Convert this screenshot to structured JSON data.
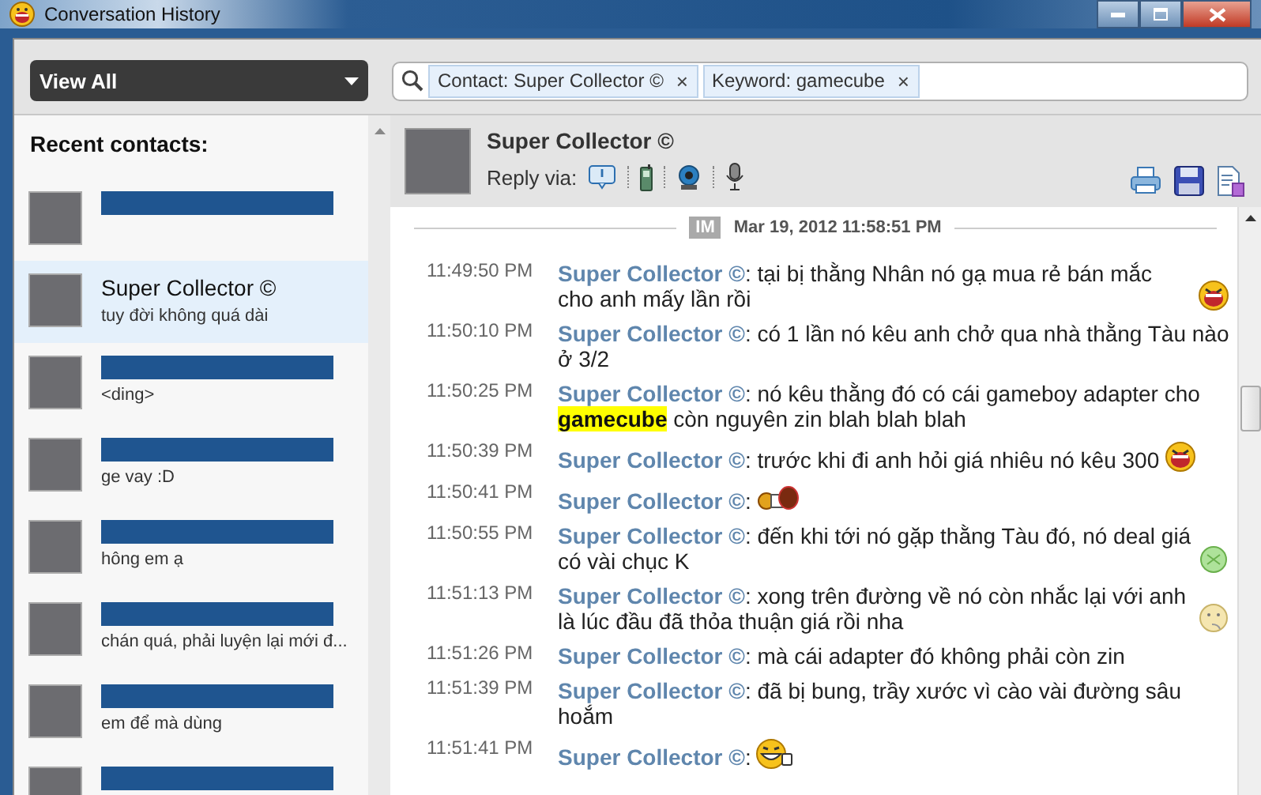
{
  "window": {
    "title": "Conversation History"
  },
  "toolbar": {
    "filter": "View All",
    "search_tokens": [
      {
        "label": "Contact: Super Collector ©",
        "remove": "×"
      },
      {
        "label": "Keyword: gamecube",
        "remove": "×"
      }
    ]
  },
  "sidebar": {
    "heading": "Recent contacts:",
    "contacts": [
      {
        "name_redacted": true,
        "selected": false
      },
      {
        "name_redacted": false,
        "name": "Super Collector ©",
        "preview": "tuy đời không quá dài",
        "selected": true
      },
      {
        "name_redacted": true,
        "preview": "<ding>",
        "selected": false
      },
      {
        "name_redacted": true,
        "preview": "ge vay :D",
        "selected": false
      },
      {
        "name_redacted": true,
        "preview": "hông em ạ",
        "selected": false
      },
      {
        "name_redacted": true,
        "preview": "chán quá, phải luyện lại mới đ...",
        "selected": false
      },
      {
        "name_redacted": true,
        "preview": "em để mà dùng",
        "selected": false
      },
      {
        "name_redacted": true,
        "selected": false
      }
    ]
  },
  "conversation": {
    "contact": "Super Collector ©",
    "reply_label": "Reply via:",
    "divider": {
      "badge": "IM",
      "date": "Mar 19, 2012 11:58:51 PM"
    },
    "messages": [
      {
        "time": "11:49:50 PM",
        "sender": "Super Collector ©",
        "text": ": tại bị thằng Nhân nó gạ mua rẻ bán mắc cho anh mấy lần rồi",
        "emoticon": {
          "kind": "laughing"
        }
      },
      {
        "time": "11:50:10 PM",
        "sender": "Super Collector ©",
        "text": ": có 1 lần nó kêu anh chở qua nhà thằng Tàu nào ở 3/2"
      },
      {
        "time": "11:50:25 PM",
        "sender": "Super Collector ©",
        "text": ": nó kêu thằng đó có cái gameboy adapter cho **gamecube** còn nguyên zin blah blah blah"
      },
      {
        "time": "11:50:39 PM",
        "sender": "Super Collector ©",
        "text": ": trước khi đi anh hỏi giá nhiêu nó kêu 300",
        "emoticon": {
          "kind": "laughing"
        }
      },
      {
        "time": "11:50:41 PM",
        "sender": "Super Collector ©",
        "text": ":",
        "emoticon": {
          "kind": "drum"
        }
      },
      {
        "time": "11:50:55 PM",
        "sender": "Super Collector ©",
        "text": ": đến khi tới nó gặp thằng Tàu đó, nó deal giá có vài chục K",
        "emoticon": {
          "kind": "ball"
        }
      },
      {
        "time": "11:51:13 PM",
        "sender": "Super Collector ©",
        "text": ": xong trên đường về nó còn nhắc lại với anh là lúc đầu đã thỏa thuận giá rồi nha",
        "emoticon": {
          "kind": "thinking"
        }
      },
      {
        "time": "11:51:26 PM",
        "sender": "Super Collector ©",
        "text": ": mà cái adapter đó không phải còn zin"
      },
      {
        "time": "11:51:39 PM",
        "sender": "Super Collector ©",
        "text": ": đã bị bung, trầy xước vì cào vài đường sâu hoắm"
      },
      {
        "time": "11:51:41 PM",
        "sender": "Super Collector ©",
        "text": ":",
        "emoticon": {
          "kind": "waving"
        }
      }
    ]
  }
}
